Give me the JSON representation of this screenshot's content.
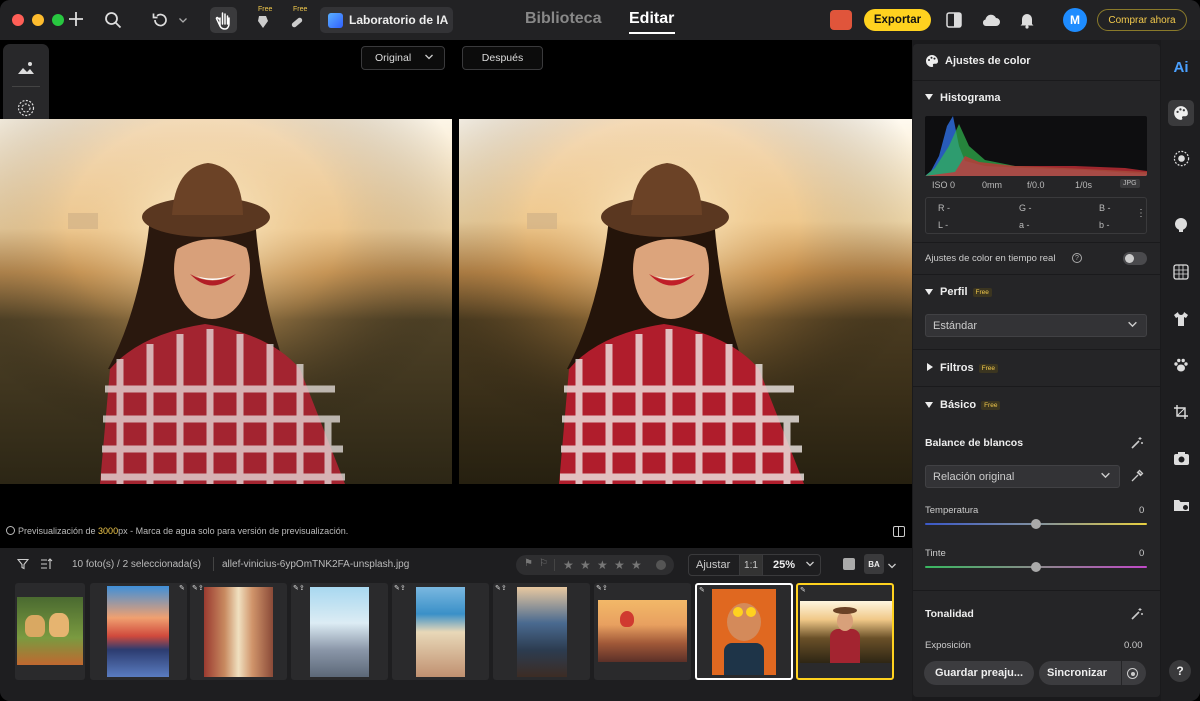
{
  "topbar": {
    "ai_lab_label": "Laboratorio de IA",
    "free_badge_1": "Free",
    "free_badge_2": "Free",
    "nav_library": "Biblioteca",
    "nav_edit": "Editar",
    "export_label": "Exportar",
    "avatar_initial": "M",
    "buy_label": "Comprar ahora"
  },
  "canvas": {
    "view_select": "Original",
    "after_label": "Después",
    "preview_prefix": "Previsualización de ",
    "preview_px": "3000",
    "preview_suffix": "px - Marca de agua solo para versión de previsualización."
  },
  "filmstrip": {
    "count_text": "10 foto(s) / 2 seleccionada(s)",
    "filename": "allef-vinicius-6ypOmTNK2FA-unsplash.jpg",
    "rating_stars": 5,
    "fit_label": "Ajustar",
    "ratio_label": "1:1",
    "zoom_value": "25%",
    "ba_label": "BA"
  },
  "panel": {
    "title": "Ajustes de color",
    "histogram_title": "Histograma",
    "exif": {
      "iso": "ISO 0",
      "focal": "0mm",
      "aperture": "f/0.0",
      "shutter": "1/0s",
      "format": "JPG"
    },
    "rgb": {
      "r": "R -",
      "g": "G -",
      "b": "B -",
      "l": "L -",
      "a": "a -",
      "b2": "b -"
    },
    "realtime_label": "Ajustes de color en tiempo real",
    "profile_title": "Perfil",
    "profile_free": "Free",
    "profile_value": "Estándar",
    "filters_title": "Filtros",
    "filters_free": "Free",
    "basic_title": "Básico",
    "basic_free": "Free",
    "wb_title": "Balance de blancos",
    "wb_value": "Relación original",
    "temp_label": "Temperatura",
    "temp_value": "0",
    "tint_label": "Tinte",
    "tint_value": "0",
    "tonality_title": "Tonalidad",
    "exposure_label": "Exposición",
    "exposure_value": "0.00",
    "save_preset": "Guardar preaju...",
    "sync_label": "Sincronizar"
  },
  "rail": {
    "ai_label": "Ai",
    "help_label": "?"
  },
  "colors": {
    "accent_yellow": "#ffd21f",
    "avatar_blue": "#1e8cff",
    "free_gold": "#f2c94c"
  }
}
